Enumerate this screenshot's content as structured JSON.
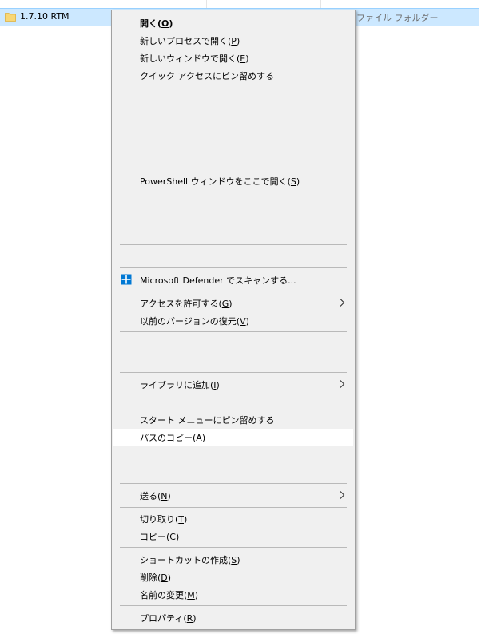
{
  "explorer": {
    "row": {
      "name": "1.7.10 RTM",
      "type": "ファイル フォルダー",
      "icon": "folder-icon"
    }
  },
  "context_menu": {
    "items": {
      "open": {
        "text": "開く",
        "mnemonic": "O"
      },
      "open_new_process": {
        "text": "新しいプロセスで開く",
        "mnemonic": "P"
      },
      "open_new_window": {
        "text": "新しいウィンドウで開く",
        "mnemonic": "E"
      },
      "pin_quick_access": {
        "text": "クイック アクセスにピン留めする"
      },
      "powershell": {
        "text": "PowerShell ウィンドウをここで開く",
        "mnemonic": "S"
      },
      "defender": {
        "text": "Microsoft Defender でスキャンする...",
        "icon": "defender-shield-icon"
      },
      "give_access": {
        "text": "アクセスを許可する",
        "mnemonic": "G"
      },
      "restore_versions": {
        "text": "以前のバージョンの復元",
        "mnemonic": "V"
      },
      "include_library": {
        "text": "ライブラリに追加",
        "mnemonic": "I"
      },
      "pin_start": {
        "text": "スタート メニューにピン留めする"
      },
      "copy_path": {
        "text": "パスのコピー",
        "mnemonic": "A"
      },
      "send_to": {
        "text": "送る",
        "mnemonic": "N"
      },
      "cut": {
        "text": "切り取り",
        "mnemonic": "T"
      },
      "copy": {
        "text": "コピー",
        "mnemonic": "C"
      },
      "create_shortcut": {
        "text": "ショートカットの作成",
        "mnemonic": "S"
      },
      "delete": {
        "text": "削除",
        "mnemonic": "D"
      },
      "rename": {
        "text": "名前の変更",
        "mnemonic": "M"
      },
      "properties": {
        "text": "プロパティ",
        "mnemonic": "R"
      }
    },
    "paren_open": "(",
    "paren_close": ")",
    "hovered_item": "copy_path",
    "colors": {
      "menu_bg": "#f0f0f0",
      "hover_bg": "#ffffff",
      "row_selected_bg": "#cce8ff",
      "defender_blue": "#0078d4"
    }
  }
}
